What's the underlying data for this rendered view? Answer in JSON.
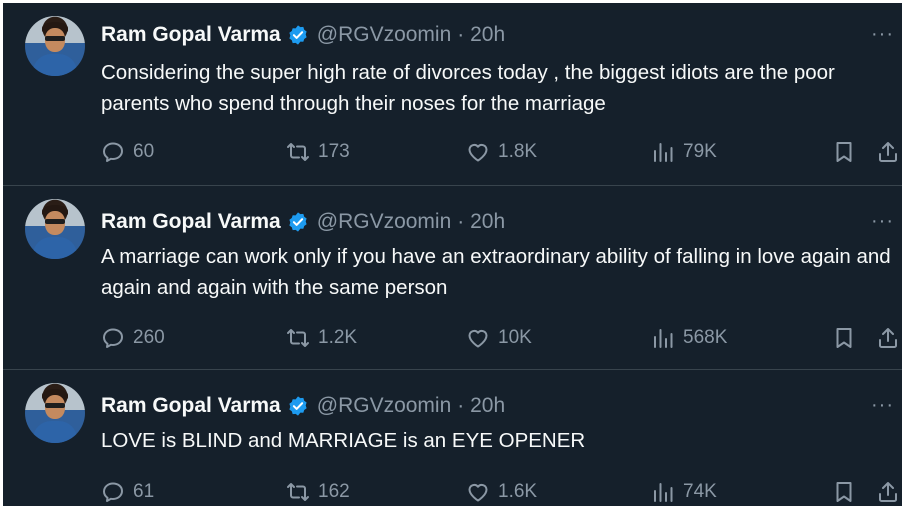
{
  "tweets": [
    {
      "author": {
        "name": "Ram Gopal Varma",
        "handle": "@RGVzoomin",
        "time": "· 20h"
      },
      "text": "Considering the super high rate of divorces today , the biggest idiots are the poor parents who spend through their noses for the marriage",
      "stats": {
        "replies": "60",
        "retweets": "173",
        "likes": "1.8K",
        "views": "79K"
      }
    },
    {
      "author": {
        "name": "Ram Gopal Varma",
        "handle": "@RGVzoomin",
        "time": "· 20h"
      },
      "text": "A marriage can work only if you have an extraordinary ability of falling in love again and again and again with the same person",
      "stats": {
        "replies": "260",
        "retweets": "1.2K",
        "likes": "10K",
        "views": "568K"
      }
    },
    {
      "author": {
        "name": "Ram Gopal Varma",
        "handle": "@RGVzoomin",
        "time": "· 20h"
      },
      "text": "LOVE is BLIND and MARRIAGE is an EYE OPENER",
      "stats": {
        "replies": "61",
        "retweets": "162",
        "likes": "1.6K",
        "views": "74K"
      }
    }
  ],
  "more_glyph": "···",
  "colors": {
    "background": "#15202b",
    "text": "#f7f9f9",
    "secondary": "#8b98a5",
    "verified": "#1d9bf0",
    "divider": "#38444d"
  },
  "icons": [
    "verified-badge-icon",
    "reply-icon",
    "retweet-icon",
    "like-icon",
    "views-icon",
    "bookmark-icon",
    "share-icon",
    "more-icon"
  ]
}
